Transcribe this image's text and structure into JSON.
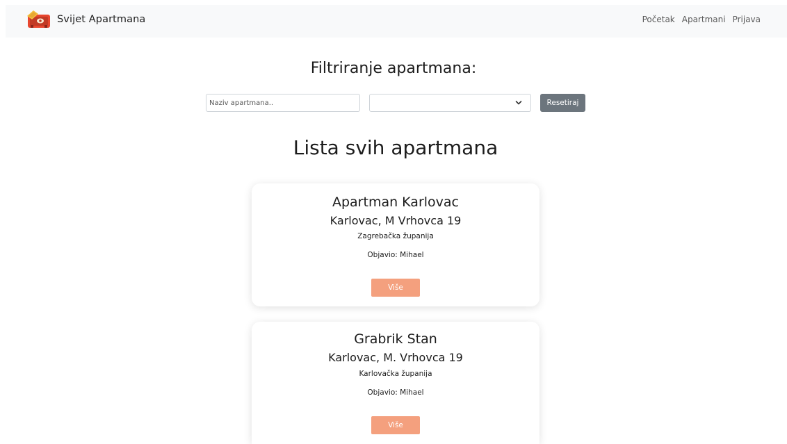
{
  "navbar": {
    "brand": "Svijet Apartmana",
    "links": [
      "Početak",
      "Apartmani",
      "Prijava"
    ]
  },
  "filter": {
    "title": "Filtriranje apartmana:",
    "name_placeholder": "Naziv apartmana..",
    "county_value": "",
    "reset_label": "Resetiraj"
  },
  "list": {
    "title": "Lista svih apartmana",
    "cards": [
      {
        "name": "Apartman Karlovac",
        "address": "Karlovac, M Vrhovca 19",
        "county": "Zagrebačka županija",
        "author": "Objavio: Mihael",
        "button": "Više"
      },
      {
        "name": "Grabrik Stan",
        "address": "Karlovac, M. Vrhovca 19",
        "county": "Karlovačka županija",
        "author": "Objavio: Mihael",
        "button": "Više"
      }
    ]
  },
  "colors": {
    "accent": "#f4a07e",
    "secondary_button": "#6c757d",
    "navbar_bg": "#f8f9fa"
  }
}
